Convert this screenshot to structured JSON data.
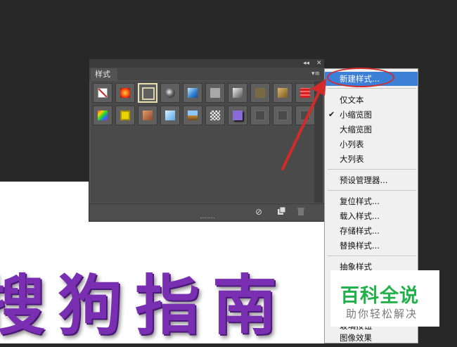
{
  "canvas": {
    "text": "搜狗指南"
  },
  "panel": {
    "tab_label": "样式",
    "collapse_glyph": "◂◂",
    "close_glyph": "✕",
    "menu_glyph": "▾≡",
    "row1": [
      "none-style",
      "red-glow",
      "outline-frame",
      "chrome-ball",
      "blue-glass",
      "gray-flat",
      "gray-gradient",
      "bronze",
      "gold",
      "red-stripes"
    ],
    "row2": [
      "rainbow",
      "yellow-button",
      "orange-gradient",
      "light-blue",
      "landscape",
      "pattern",
      "purple-shadow",
      "empty",
      "empty",
      "empty"
    ],
    "bottom_icons": [
      "no-icon",
      "new-style-icon",
      "trash-icon"
    ]
  },
  "menu": {
    "items": [
      {
        "label": "新建样式...",
        "highlight": true,
        "check": false
      },
      {
        "label": "仅文本",
        "check": false
      },
      {
        "label": "小缩览图",
        "check": true
      },
      {
        "label": "大缩览图",
        "check": false
      },
      {
        "label": "小列表",
        "check": false
      },
      {
        "label": "大列表",
        "check": false
      },
      {
        "label": "预设管理器...",
        "check": false
      },
      {
        "label": "复位样式...",
        "check": false
      },
      {
        "label": "载入样式...",
        "check": false
      },
      {
        "label": "存储样式...",
        "check": false
      },
      {
        "label": "替换样式...",
        "check": false
      },
      {
        "label": "抽象样式",
        "check": false
      },
      {
        "label": "玻璃按钮",
        "check": false
      },
      {
        "label": "图像效果",
        "check": false
      }
    ],
    "check_glyph": "✔"
  },
  "watermark": {
    "main": "百科全说",
    "sub": "助你轻松解决"
  },
  "colors": {
    "menu_highlight": "#3c7fd6",
    "annotation_red": "#d42a2a",
    "text_purple": "#7a2fb3",
    "logo_green": "#22b04a"
  }
}
